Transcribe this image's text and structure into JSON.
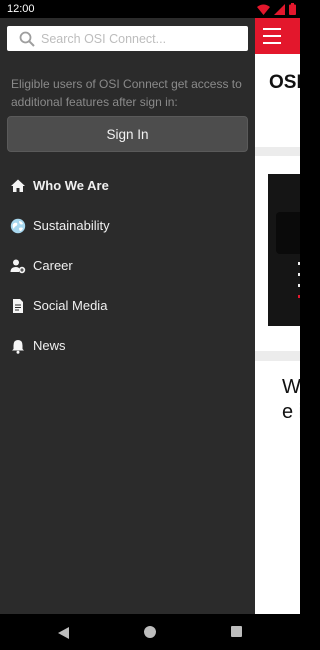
{
  "status_bar": {
    "time": "12:00"
  },
  "drawer": {
    "search": {
      "placeholder": "Search OSI Connect...",
      "value": ""
    },
    "note": "Eligible users of OSI Connect get access to additional features after sign in:",
    "sign_in_label": "Sign In",
    "nav_items": [
      {
        "label": "Who We Are",
        "icon": "home-icon",
        "active": true
      },
      {
        "label": "Sustainability",
        "icon": "globe-icon"
      },
      {
        "label": "Career",
        "icon": "person-add-icon"
      },
      {
        "label": "Social Media",
        "icon": "document-icon"
      },
      {
        "label": "News",
        "icon": "bell-icon"
      }
    ]
  },
  "page": {
    "title": "OSI",
    "body_text": "W la m th le re in fo bu"
  },
  "colors": {
    "brand_red": "#e3172c",
    "drawer_bg": "#2b2b2b",
    "button_bg": "#4d4d4d"
  }
}
